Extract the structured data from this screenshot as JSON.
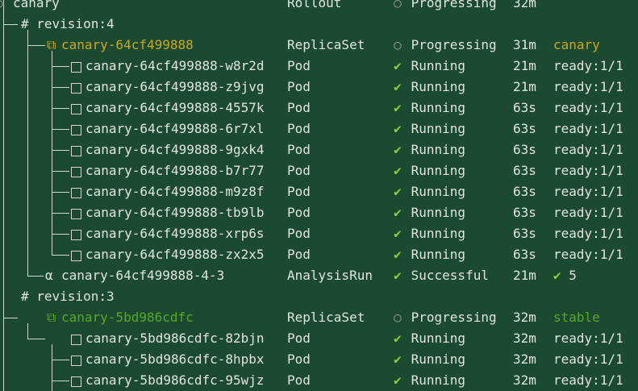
{
  "rows": [
    {
      "type": "rollout",
      "name": "canary",
      "kind": "Rollout",
      "status_icon": "○",
      "status": "Progressing",
      "age": "32m",
      "info": ""
    },
    {
      "type": "revision",
      "label": "# revision:4"
    },
    {
      "type": "rs",
      "name": "canary-64cf499888",
      "kind": "ReplicaSet",
      "status_icon": "○",
      "status": "Progressing",
      "age": "31m",
      "info": "canary"
    },
    {
      "type": "pod",
      "name": "canary-64cf499888-w8r2d",
      "kind": "Pod",
      "status_icon": "✔",
      "status": "Running",
      "age": "21m",
      "info": "ready:1/1"
    },
    {
      "type": "pod",
      "name": "canary-64cf499888-z9jvg",
      "kind": "Pod",
      "status_icon": "✔",
      "status": "Running",
      "age": "21m",
      "info": "ready:1/1"
    },
    {
      "type": "pod",
      "name": "canary-64cf499888-4557k",
      "kind": "Pod",
      "status_icon": "✔",
      "status": "Running",
      "age": "63s",
      "info": "ready:1/1"
    },
    {
      "type": "pod",
      "name": "canary-64cf499888-6r7xl",
      "kind": "Pod",
      "status_icon": "✔",
      "status": "Running",
      "age": "63s",
      "info": "ready:1/1"
    },
    {
      "type": "pod",
      "name": "canary-64cf499888-9gxk4",
      "kind": "Pod",
      "status_icon": "✔",
      "status": "Running",
      "age": "63s",
      "info": "ready:1/1"
    },
    {
      "type": "pod",
      "name": "canary-64cf499888-b7r77",
      "kind": "Pod",
      "status_icon": "✔",
      "status": "Running",
      "age": "63s",
      "info": "ready:1/1"
    },
    {
      "type": "pod",
      "name": "canary-64cf499888-m9z8f",
      "kind": "Pod",
      "status_icon": "✔",
      "status": "Running",
      "age": "63s",
      "info": "ready:1/1"
    },
    {
      "type": "pod",
      "name": "canary-64cf499888-tb9lb",
      "kind": "Pod",
      "status_icon": "✔",
      "status": "Running",
      "age": "63s",
      "info": "ready:1/1"
    },
    {
      "type": "pod",
      "name": "canary-64cf499888-xrp6s",
      "kind": "Pod",
      "status_icon": "✔",
      "status": "Running",
      "age": "63s",
      "info": "ready:1/1"
    },
    {
      "type": "pod",
      "name": "canary-64cf499888-zx2x5",
      "kind": "Pod",
      "status_icon": "✔",
      "status": "Running",
      "age": "63s",
      "info": "ready:1/1"
    },
    {
      "type": "analysis",
      "icon": "α",
      "name": "canary-64cf499888-4-3",
      "kind": "AnalysisRun",
      "status_icon": "✔",
      "status": "Successful",
      "age": "21m",
      "info_icon": "✔",
      "info": "5"
    },
    {
      "type": "revision",
      "label": "# revision:3"
    },
    {
      "type": "rs",
      "name": "canary-5bd986cdfc",
      "kind": "ReplicaSet",
      "status_icon": "○",
      "status": "Progressing",
      "age": "32m",
      "info": "stable"
    },
    {
      "type": "pod",
      "name": "canary-5bd986cdfc-82bjn",
      "kind": "Pod",
      "status_icon": "✔",
      "status": "Running",
      "age": "32m",
      "info": "ready:1/1"
    },
    {
      "type": "pod",
      "name": "canary-5bd986cdfc-8hpbx",
      "kind": "Pod",
      "status_icon": "✔",
      "status": "Running",
      "age": "32m",
      "info": "ready:1/1"
    },
    {
      "type": "pod",
      "name": "canary-5bd986cdfc-95wjz",
      "kind": "Pod",
      "status_icon": "✔",
      "status": "Running",
      "age": "32m",
      "info": "ready:1/1"
    }
  ],
  "colors": {
    "background": "#1c4a30",
    "text": "#dfe6dd",
    "ok": "#8fcf3a",
    "canary": "#c8a820",
    "stable": "#58a628"
  }
}
